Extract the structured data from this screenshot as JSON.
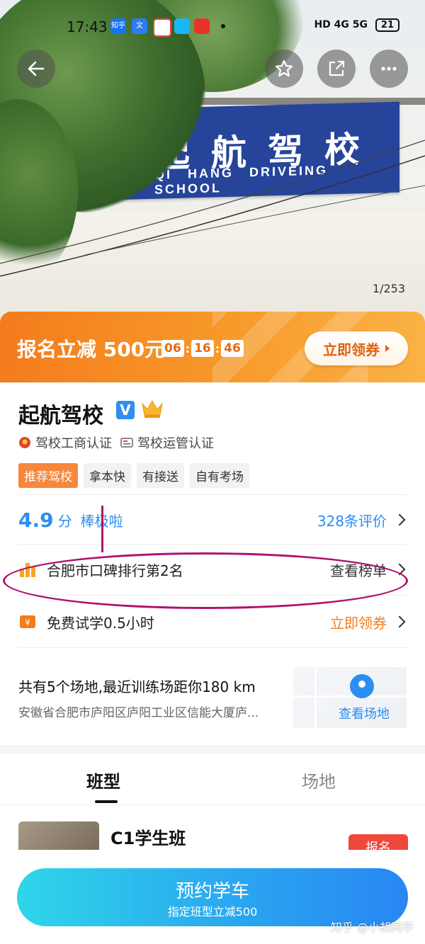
{
  "status_bar": {
    "time": "17:43",
    "indicators": "HD 4G 5G",
    "battery": "21",
    "app_icons": [
      "知乎",
      "文"
    ]
  },
  "hero": {
    "banner_cn": "起航驾校",
    "banner_en": "QI HANG DRIVEING SCHOOL",
    "photo_counter": "1/253"
  },
  "top_actions": {
    "back_icon": "arrow-left-icon",
    "favorite_icon": "star-icon",
    "share_icon": "share-icon",
    "more_icon": "more-icon"
  },
  "promo": {
    "prefix": "报名立减",
    "amount": "500元",
    "timer": [
      "06",
      "16",
      "46"
    ],
    "claim_label": "立即领券"
  },
  "school": {
    "name": "起航驾校",
    "verify_mark": "V",
    "certs": [
      "驾校工商认证",
      "驾校运管认证"
    ],
    "tags": [
      "推荐驾校",
      "拿本快",
      "有接送",
      "自有考场"
    ]
  },
  "rating": {
    "score": "4.9",
    "unit": "分",
    "desc": "棒极啦",
    "reviews_label": "328条评价"
  },
  "ranking": {
    "text": "合肥市口碑排行第2名",
    "link": "查看榜单"
  },
  "trial": {
    "text": "免费试学0.5小时",
    "link": "立即领券"
  },
  "venue": {
    "summary": "共有5个场地,最近训练场距你180 km",
    "address": "安徽省合肥市庐阳区庐阳工业区信能大厦庐...",
    "link": "查看场地"
  },
  "tabs": [
    "班型",
    "场地"
  ],
  "course": {
    "name": "C1学生班",
    "signup": "报名"
  },
  "bottom": {
    "book_label": "预约学车",
    "book_sub": "指定班型立减500"
  },
  "watermark": "知乎 @小胡同学",
  "colors": {
    "accent_blue": "#2b8ef2",
    "promo_orange": "#f47c1c",
    "annotation": "#b0126e"
  }
}
